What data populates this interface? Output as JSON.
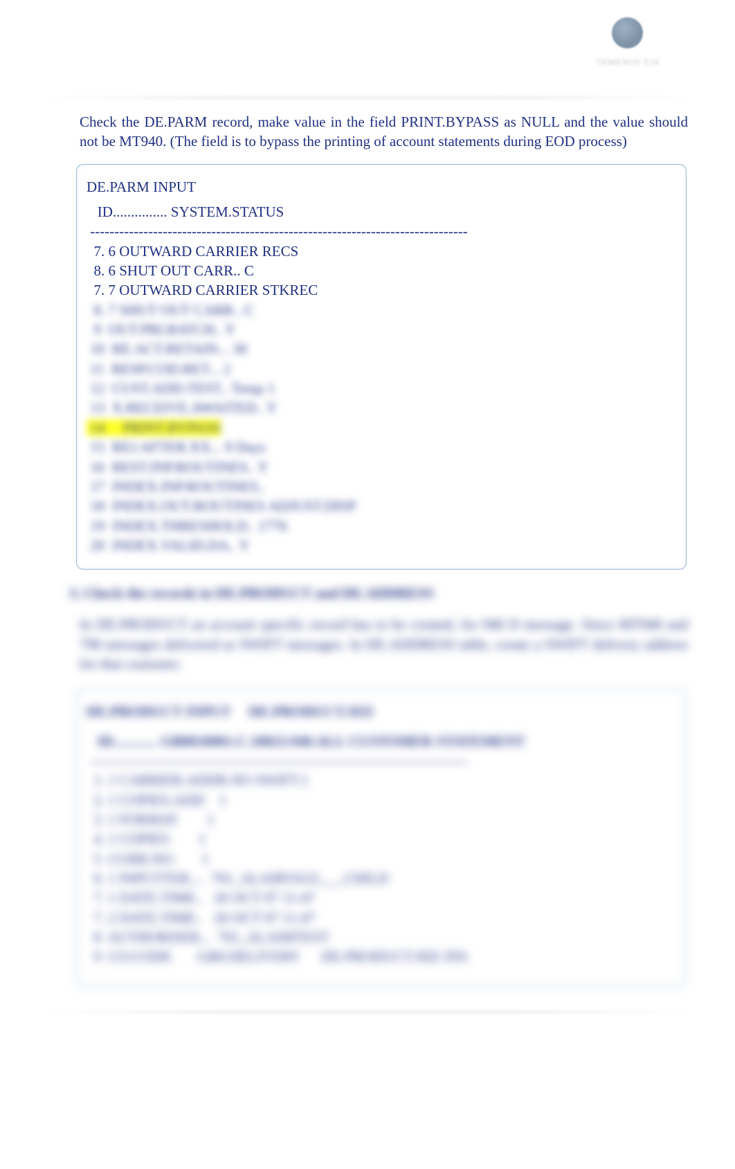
{
  "logo_text": "TEMENOS T24",
  "intro": "Check the DE.PARM record, make value in the field PRINT.BYPASS as NULL and the value should not be MT940. (The field is to bypass the printing of account statements during EOD process)",
  "block1": {
    "title": "DE.PARM INPUT",
    "id_line": "   ID............... SYSTEM.STATUS",
    "divider": " ------------------------------------------------------------------------------",
    "visible_lines": [
      "  7. 6 OUTWARD CARRIER RECS",
      "  8. 6 SHUT OUT CARR.. C",
      "  7. 7 OUTWARD CARRIER STKREC"
    ],
    "blurred_lines": [
      "  8. 7 SHUT OUT CARR.. C",
      "  9  OUT.PRI.BATCH.. Y",
      " 10  RE.ACT.RETAIN... 30",
      " 11  RESP.COD.RET... 2",
      " 12  CUST.ADD.TEST.. Temp 1",
      " 13  X.RECEIVE.AWAITED.. Y",
      " 14     PRINT.BYPASS",
      " 15  REJ.AFTER.XX... 9 Days",
      " 16  REST.INP.ROUTINES.. Y",
      " 17  INDEX.INP.ROUTINES.. ",
      " 18  INDEX.OUT.ROUTINES ADJUST.DISP",
      " 19  INDEX.THRESHOLD.. 1776",
      " 20  INDEX.VALID.DA.. Y"
    ],
    "highlight_index": 6
  },
  "section3": {
    "heading": "3.   Check the records in DE.PRODUCT and DE.ADDRESS",
    "para": "In DE.PRODUCT an account specific record has to be created, for 940 D message. Since MT940 and 790 messages delivered as SWIFT messages. In DE.ADDRESS table, create a SWIFT delivery address for that customer."
  },
  "block2": {
    "title": "DE.PRODUCT INPUT     DE.PRODUCT.SEE",
    "id_line": "   ID............ GB0010001.C.10023.940.ALL CUSTOMER STATEMENT",
    "divider": " ------------------------------------------------------------------------------",
    "blurred_lines": [
      "  1. 1 CARRIER.ADDR.NO SWIFT.1",
      "  2. 1 COPIES.ADD    1  ",
      "  3. 1 FORMAT        1",
      "  4. 1 COPIES        1",
      "  5  CURR.NO.       1",
      "  6. 1 INPUTTER....  701_ALAIRVAUL___CHILD",
      "  7. 1 DATE.TIME..   26 OCT 07 11:47",
      "  7. 2 DATE.TIME..   26 OCT 07 11:47",
      "  8  AUTHORISER...  701_ALAIMTEST",
      "  9  CO.CODE       GB0.DELIVERY      DE.PRODUCT.SEE INS"
    ]
  }
}
